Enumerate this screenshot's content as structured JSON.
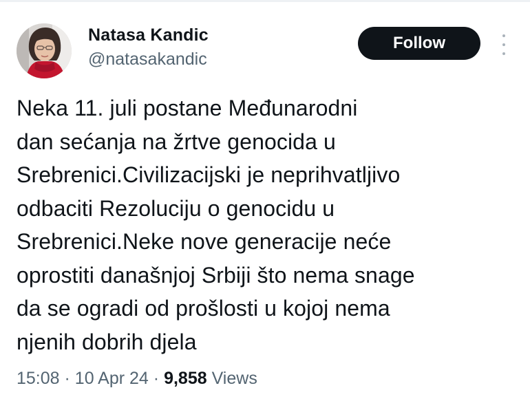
{
  "author": {
    "name": "Natasa Kandic",
    "handle": "@natasakandic"
  },
  "actions": {
    "follow_label": "Follow",
    "more_icon": "more-vertical-icon"
  },
  "tweet": {
    "lines": [
      "Neka 11. juli postane Međunarodni",
      "dan sećanja na žrtve genocida u",
      "Srebrenici.Civilizacijski je neprihvatljivo",
      "odbaciti Rezoluciju o genocidu u",
      "Srebrenici.Neke nove generacije neće",
      "oprostiti današnjoj Srbiji što nema snage",
      "da se ogradi od prošlosti u kojoj nema",
      "njenih dobrih djela"
    ]
  },
  "meta": {
    "time": "15:08",
    "separator": "·",
    "date": "10 Apr 24",
    "views_count": "9,858",
    "views_label": "Views"
  },
  "colors": {
    "text": "#0f1419",
    "secondary": "#536471",
    "button_bg": "#0f1419",
    "button_text": "#ffffff"
  }
}
